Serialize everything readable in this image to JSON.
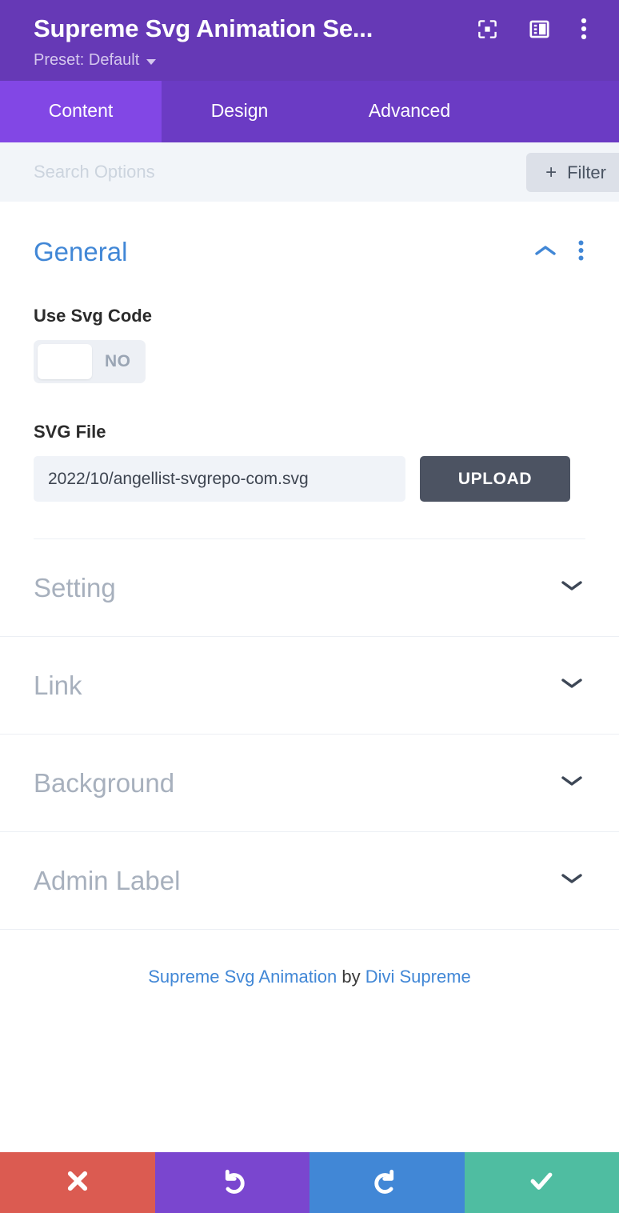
{
  "header": {
    "module_title": "Supreme Svg Animation Se...",
    "preset_label": "Preset: Default",
    "icons": {
      "focus": "focus-frame-icon",
      "layout": "layout-panel-icon",
      "more": "more-vertical-icon"
    },
    "colors": {
      "background": "#6639b6",
      "preset_text": "#d5c8ee"
    }
  },
  "tabs": [
    {
      "label": "Content",
      "active": true
    },
    {
      "label": "Design",
      "active": false
    },
    {
      "label": "Advanced",
      "active": false
    }
  ],
  "tabs_colors": {
    "active_bg": "#8247e5",
    "inactive_bg": "#6b3bc4"
  },
  "search": {
    "placeholder": "Search Options",
    "value": "",
    "filter_label": "Filter",
    "filter_plus": "+"
  },
  "general": {
    "title": "General",
    "collapse_icon": "chevron-up-icon",
    "menu_icon": "more-vertical-icon",
    "accent_color": "#4187d6",
    "fields": {
      "use_svg_code": {
        "label": "Use Svg Code",
        "toggle_state": "NO"
      },
      "svg_file": {
        "label": "SVG File",
        "value": "2022/10/angellist-svgrepo-com.svg",
        "upload_label": "UPLOAD"
      }
    }
  },
  "collapsed_sections": [
    {
      "title": "Setting"
    },
    {
      "title": "Link"
    },
    {
      "title": "Background"
    },
    {
      "title": "Admin Label"
    }
  ],
  "credit": {
    "module_link": "Supreme Svg Animation",
    "by": " by ",
    "vendor_link": "Divi Supreme"
  },
  "footer_buttons": [
    {
      "name": "close",
      "icon": "close-x-icon",
      "color": "#db5b51"
    },
    {
      "name": "undo",
      "icon": "undo-arrow-icon",
      "color": "#7a46cf"
    },
    {
      "name": "redo",
      "icon": "redo-arrow-icon",
      "color": "#4187d6"
    },
    {
      "name": "save",
      "icon": "checkmark-icon",
      "color": "#4fbda1"
    }
  ]
}
